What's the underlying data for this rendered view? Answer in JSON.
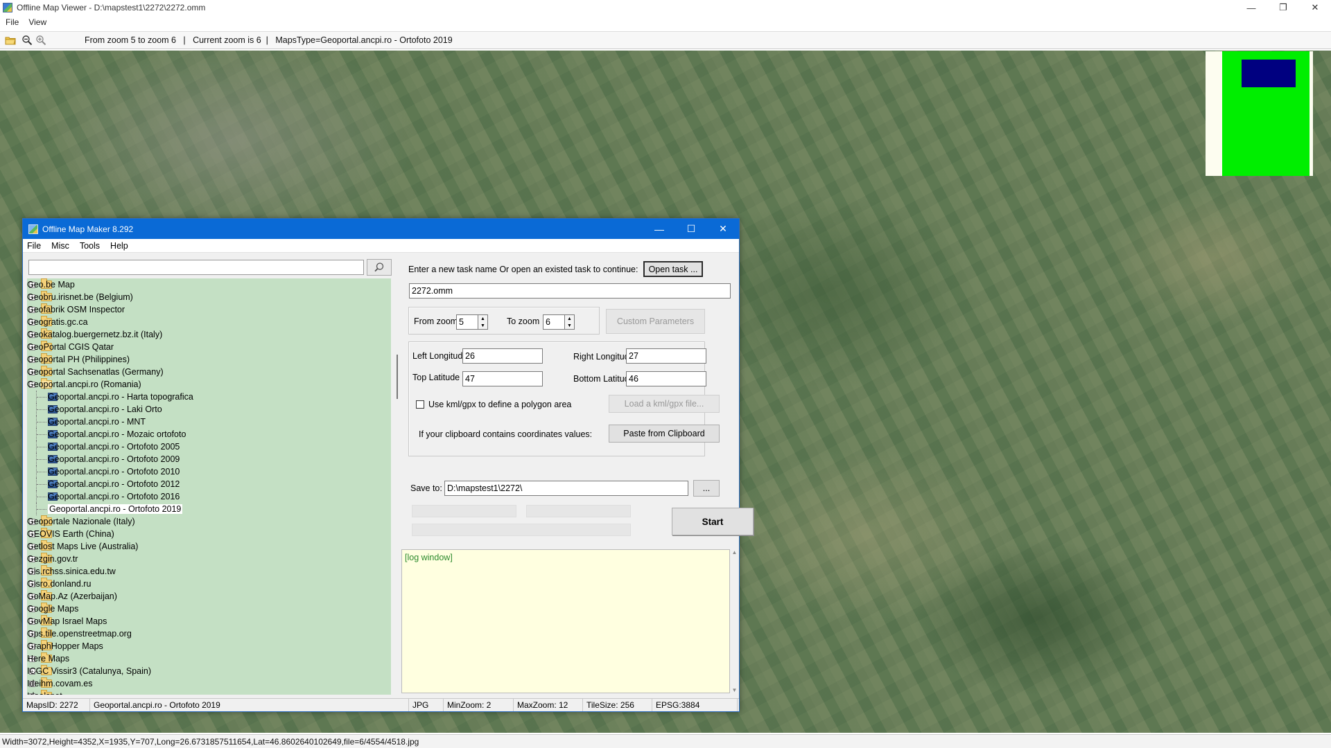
{
  "viewer": {
    "title": "Offline Map Viewer - D:\\mapstest1\\2272\\2272.omm",
    "menu": [
      "File",
      "View"
    ],
    "toolbar_status": "From zoom 5 to zoom 6   |   Current zoom is 6  |   MapsType=Geoportal.ancpi.ro - Ortofoto 2019",
    "status": "Width=3072,Height=4352,X=1935,Y=707,Long=26.6731857511654,Lat=46.8602640102649,file=6/4554/4518.jpg",
    "window_controls": {
      "minimize": "—",
      "maximize": "❐",
      "close": "✕"
    }
  },
  "maker": {
    "title": "Offline Map Maker 8.292",
    "menu": [
      "File",
      "Misc",
      "Tools",
      "Help"
    ],
    "search": {
      "value": "",
      "placeholder": ""
    },
    "tree": [
      {
        "label": "Geo.be Map",
        "type": "folder"
      },
      {
        "label": "Geobru.irisnet.be (Belgium)",
        "type": "folder"
      },
      {
        "label": "Geofabrik OSM Inspector",
        "type": "folder"
      },
      {
        "label": "Geogratis.gc.ca",
        "type": "folder"
      },
      {
        "label": "Geokatalog.buergernetz.bz.it (Italy)",
        "type": "folder"
      },
      {
        "label": "GeoPortal CGIS Qatar",
        "type": "folder"
      },
      {
        "label": "Geoportal PH (Philippines)",
        "type": "folder"
      },
      {
        "label": "Geoportal Sachsenatlas (Germany)",
        "type": "folder"
      },
      {
        "label": "Geoportal.ancpi.ro (Romania)",
        "type": "open"
      },
      {
        "label": "Geoportal.ancpi.ro - Harta topografica",
        "type": "map"
      },
      {
        "label": "Geoportal.ancpi.ro - Laki Orto",
        "type": "map"
      },
      {
        "label": "Geoportal.ancpi.ro - MNT",
        "type": "map"
      },
      {
        "label": "Geoportal.ancpi.ro - Mozaic ortofoto",
        "type": "map"
      },
      {
        "label": "Geoportal.ancpi.ro - Ortofoto 2005",
        "type": "map"
      },
      {
        "label": "Geoportal.ancpi.ro - Ortofoto 2009",
        "type": "map"
      },
      {
        "label": "Geoportal.ancpi.ro - Ortofoto 2010",
        "type": "map"
      },
      {
        "label": "Geoportal.ancpi.ro - Ortofoto 2012",
        "type": "map"
      },
      {
        "label": "Geoportal.ancpi.ro - Ortofoto 2016",
        "type": "map"
      },
      {
        "label": "Geoportal.ancpi.ro - Ortofoto 2019",
        "type": "map",
        "selected": true
      },
      {
        "label": "Geoportale Nazionale (Italy)",
        "type": "folder"
      },
      {
        "label": "GEOVIS Earth (China)",
        "type": "folder"
      },
      {
        "label": "Getlost Maps Live (Australia)",
        "type": "folder"
      },
      {
        "label": "Gezgin.gov.tr",
        "type": "folder"
      },
      {
        "label": "Gis.rchss.sinica.edu.tw",
        "type": "folder"
      },
      {
        "label": "Gisro.donland.ru",
        "type": "folder"
      },
      {
        "label": "GoMap.Az (Azerbaijan)",
        "type": "folder"
      },
      {
        "label": "Google Maps",
        "type": "folder"
      },
      {
        "label": "GovMap Israel Maps",
        "type": "folder"
      },
      {
        "label": "Gps.tile.openstreetmap.org",
        "type": "folder"
      },
      {
        "label": "GraphHopper Maps",
        "type": "folder"
      },
      {
        "label": "Here Maps",
        "type": "folder"
      },
      {
        "label": "ICGC Vissir3 (Catalunya, Spain)",
        "type": "folder"
      },
      {
        "label": "Ideihm.covam.es",
        "type": "folder"
      },
      {
        "label": "Idealspot",
        "type": "folder"
      }
    ],
    "task_prompt": "Enter a new task name Or open an existed task to continue:",
    "open_task_label": "Open task ...",
    "task_name": "2272.omm",
    "from_zoom_label": "From zoom",
    "from_zoom": "5",
    "to_zoom_label": "To zoom",
    "to_zoom": "6",
    "custom_params_label": "Custom Parameters",
    "left_lon_label": "Left Longitude",
    "left_lon": "26",
    "right_lon_label": "Right Longitude",
    "right_lon": "27",
    "top_lat_label": "Top Latitude",
    "top_lat": "47",
    "bottom_lat_label": "Bottom Latitude",
    "bottom_lat": "46",
    "kml_label": "Use kml/gpx to define a polygon area",
    "load_kml_label": "Load a kml/gpx file...",
    "clipboard_text": "If your clipboard contains coordinates values:",
    "paste_label": "Paste from Clipboard",
    "save_to_label": "Save to:",
    "save_path": "D:\\mapstest1\\2272\\",
    "browse_label": "...",
    "start_label": "Start",
    "log_text": "[log window]",
    "status": {
      "maps_id": "MapsID: 2272",
      "maps_name": "Geoportal.ancpi.ro - Ortofoto 2019",
      "format": "JPG",
      "min_zoom": "MinZoom: 2",
      "max_zoom": "MaxZoom: 12",
      "tile_size": "TileSize: 256",
      "epsg": "EPSG:3884"
    },
    "window_controls": {
      "minimize": "—",
      "maximize": "☐",
      "close": "✕"
    }
  },
  "colors": {
    "maker_title": "#0a6ad6",
    "tree_bg": "#c4e0c4",
    "log_bg": "#ffffe0",
    "minimap_green": "#00ee00",
    "minimap_view": "#000080"
  }
}
